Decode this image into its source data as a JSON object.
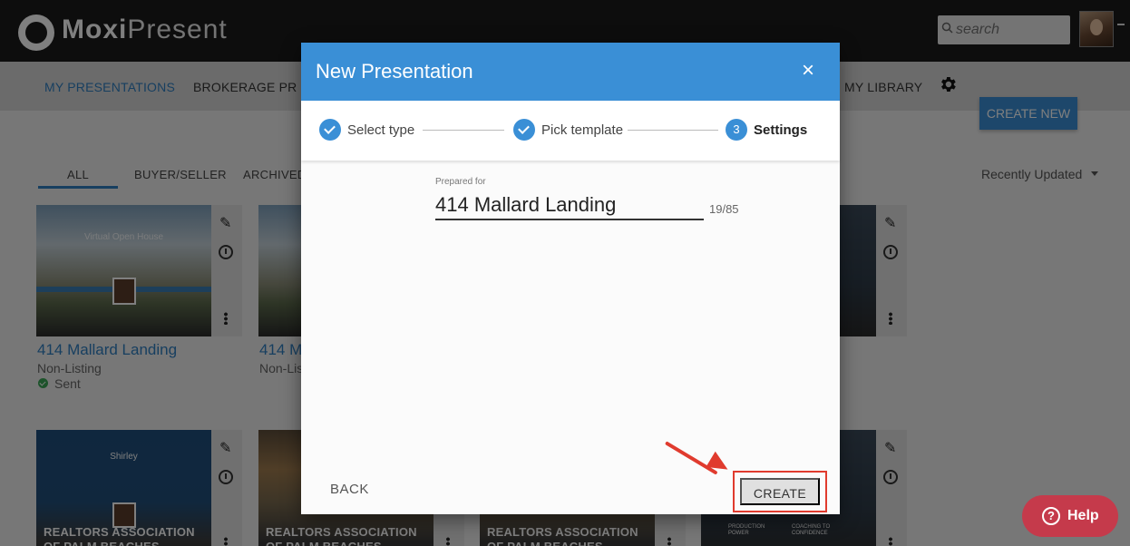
{
  "topbar": {
    "brand_bold": "Moxi",
    "brand_light": "Present",
    "search_placeholder": "search",
    "search_icon": "search-icon"
  },
  "nav": {
    "items": [
      "MY PRESENTATIONS",
      "BROKERAGE PR",
      "MY LIBRARY"
    ],
    "create_new": "CREATE NEW",
    "gear_icon": "gear-icon"
  },
  "filters": {
    "tabs": [
      "ALL",
      "BUYER/SELLER",
      "ARCHIVED"
    ],
    "sort": "Recently Updated"
  },
  "cards": {
    "c1": {
      "title": "414 Mallard Landing",
      "sub": "Non-Listing",
      "status": "Sent",
      "thumb_caption": "Virtual Open House"
    },
    "c2": {
      "title": "414 M",
      "sub": "Non-Lis"
    },
    "r2c1": {
      "thumb_title": "Shirley",
      "bottom": "REALTORS ASSOCIATION OF PALM BEACHES"
    },
    "r2c2": {
      "bottom": "REALTORS ASSOCIATION OF PALM BEACHES"
    },
    "r2c3": {
      "bottom": "REALTORS ASSOCIATION OF PALM BEACHES"
    },
    "r2c4": {
      "line1": "PRODUCTION",
      "line2": "POWER",
      "line3": "COACHING TO",
      "line4": "CONFIDENCE"
    }
  },
  "modal": {
    "title": "New Presentation",
    "close": "×",
    "steps": [
      {
        "label": "Select type",
        "state": "done"
      },
      {
        "label": "Pick template",
        "state": "done"
      },
      {
        "label": "Settings",
        "state": "current",
        "number": "3"
      }
    ],
    "prepared_label": "Prepared for",
    "prepared_value": "414 Mallard Landing",
    "char_count": "19/85",
    "back": "BACK",
    "create": "CREATE"
  },
  "help": {
    "label": "Help",
    "icon": "?"
  },
  "colors": {
    "primary": "#3a8fd6",
    "highlight": "#e03b2e",
    "help": "#c53a4b",
    "sent": "#3aa657"
  }
}
